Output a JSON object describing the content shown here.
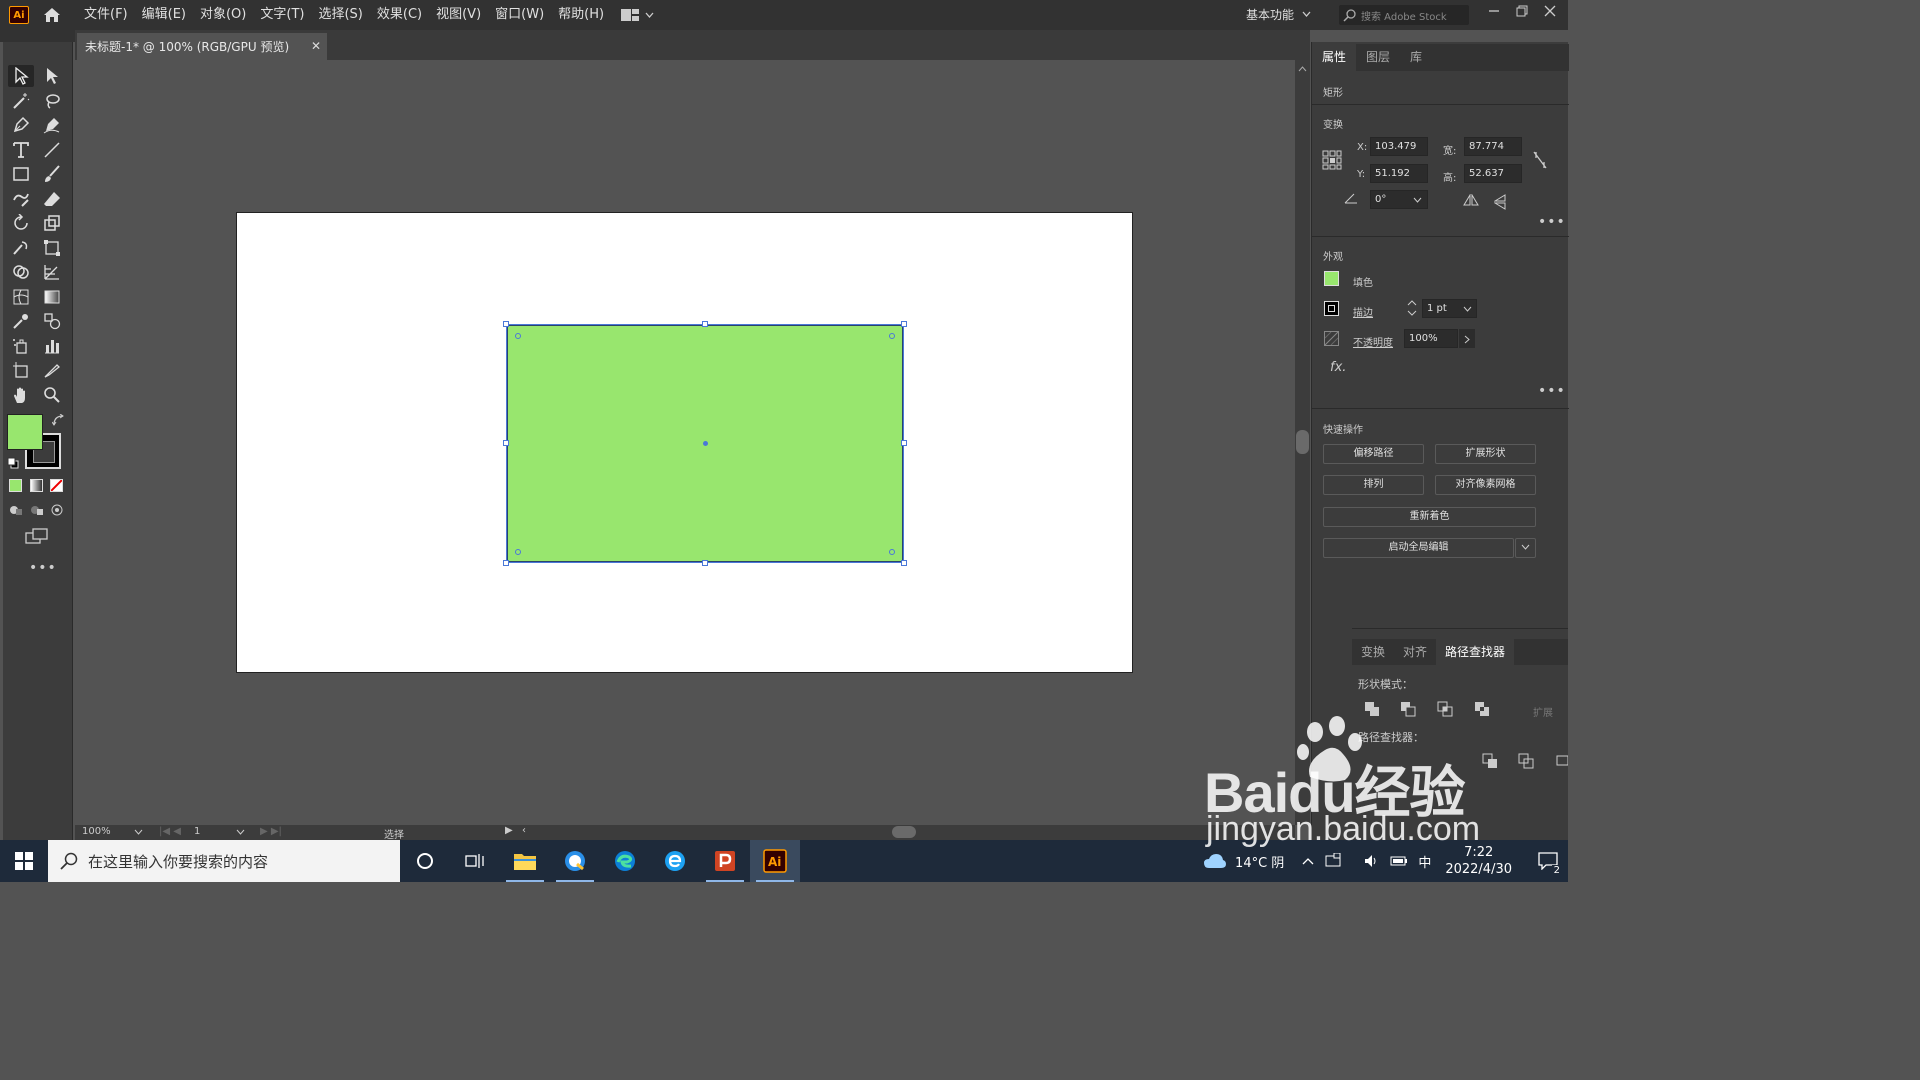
{
  "menubar": {
    "logo": "Ai",
    "menus": [
      "文件(F)",
      "编辑(E)",
      "对象(O)",
      "文字(T)",
      "选择(S)",
      "效果(C)",
      "视图(V)",
      "窗口(W)",
      "帮助(H)"
    ],
    "workspace": "基本功能",
    "stock_placeholder": "搜索 Adobe Stock"
  },
  "document": {
    "tab_title": "未标题-1* @ 100% (RGB/GPU 预览)",
    "fill_color": "#98e66e",
    "stroke_color": "#29446b"
  },
  "status": {
    "zoom": "100%",
    "artboard": "1",
    "tool": "选择"
  },
  "properties": {
    "tabs": [
      "属性",
      "图层",
      "库"
    ],
    "object_type": "矩形",
    "transform_label": "变换",
    "x_label": "X:",
    "x": "103.479",
    "y_label": "Y:",
    "y": "51.192",
    "w_label": "宽:",
    "w": "87.774",
    "h_label": "高:",
    "h": "52.637",
    "angle": "0°",
    "appearance_label": "外观",
    "fill_label": "填色",
    "stroke_label": "描边",
    "stroke_weight": "1 pt",
    "opacity_label": "不透明度",
    "opacity": "100%",
    "fx_label": "fx.",
    "quick_actions_label": "快速操作",
    "buttons": {
      "offset_path": "偏移路径",
      "expand_shape": "扩展形状",
      "arrange": "排列",
      "align_pixel": "对齐像素网格",
      "recolor": "重新着色",
      "global_edit": "启动全局编辑"
    }
  },
  "pathfinder": {
    "tabs": [
      "变换",
      "对齐",
      "路径查找器"
    ],
    "shape_modes": "形状模式：",
    "expand": "扩展",
    "pathfinders": "路径查找器："
  },
  "taskbar": {
    "search_placeholder": "在这里输入你要搜索的内容",
    "weather": "14°C 阴",
    "ime": "中",
    "time": "7:22",
    "date": "2022/4/30",
    "notifications": "2"
  },
  "watermark": {
    "brand": "Baidu经验",
    "url": "jingyan.baidu.com"
  }
}
